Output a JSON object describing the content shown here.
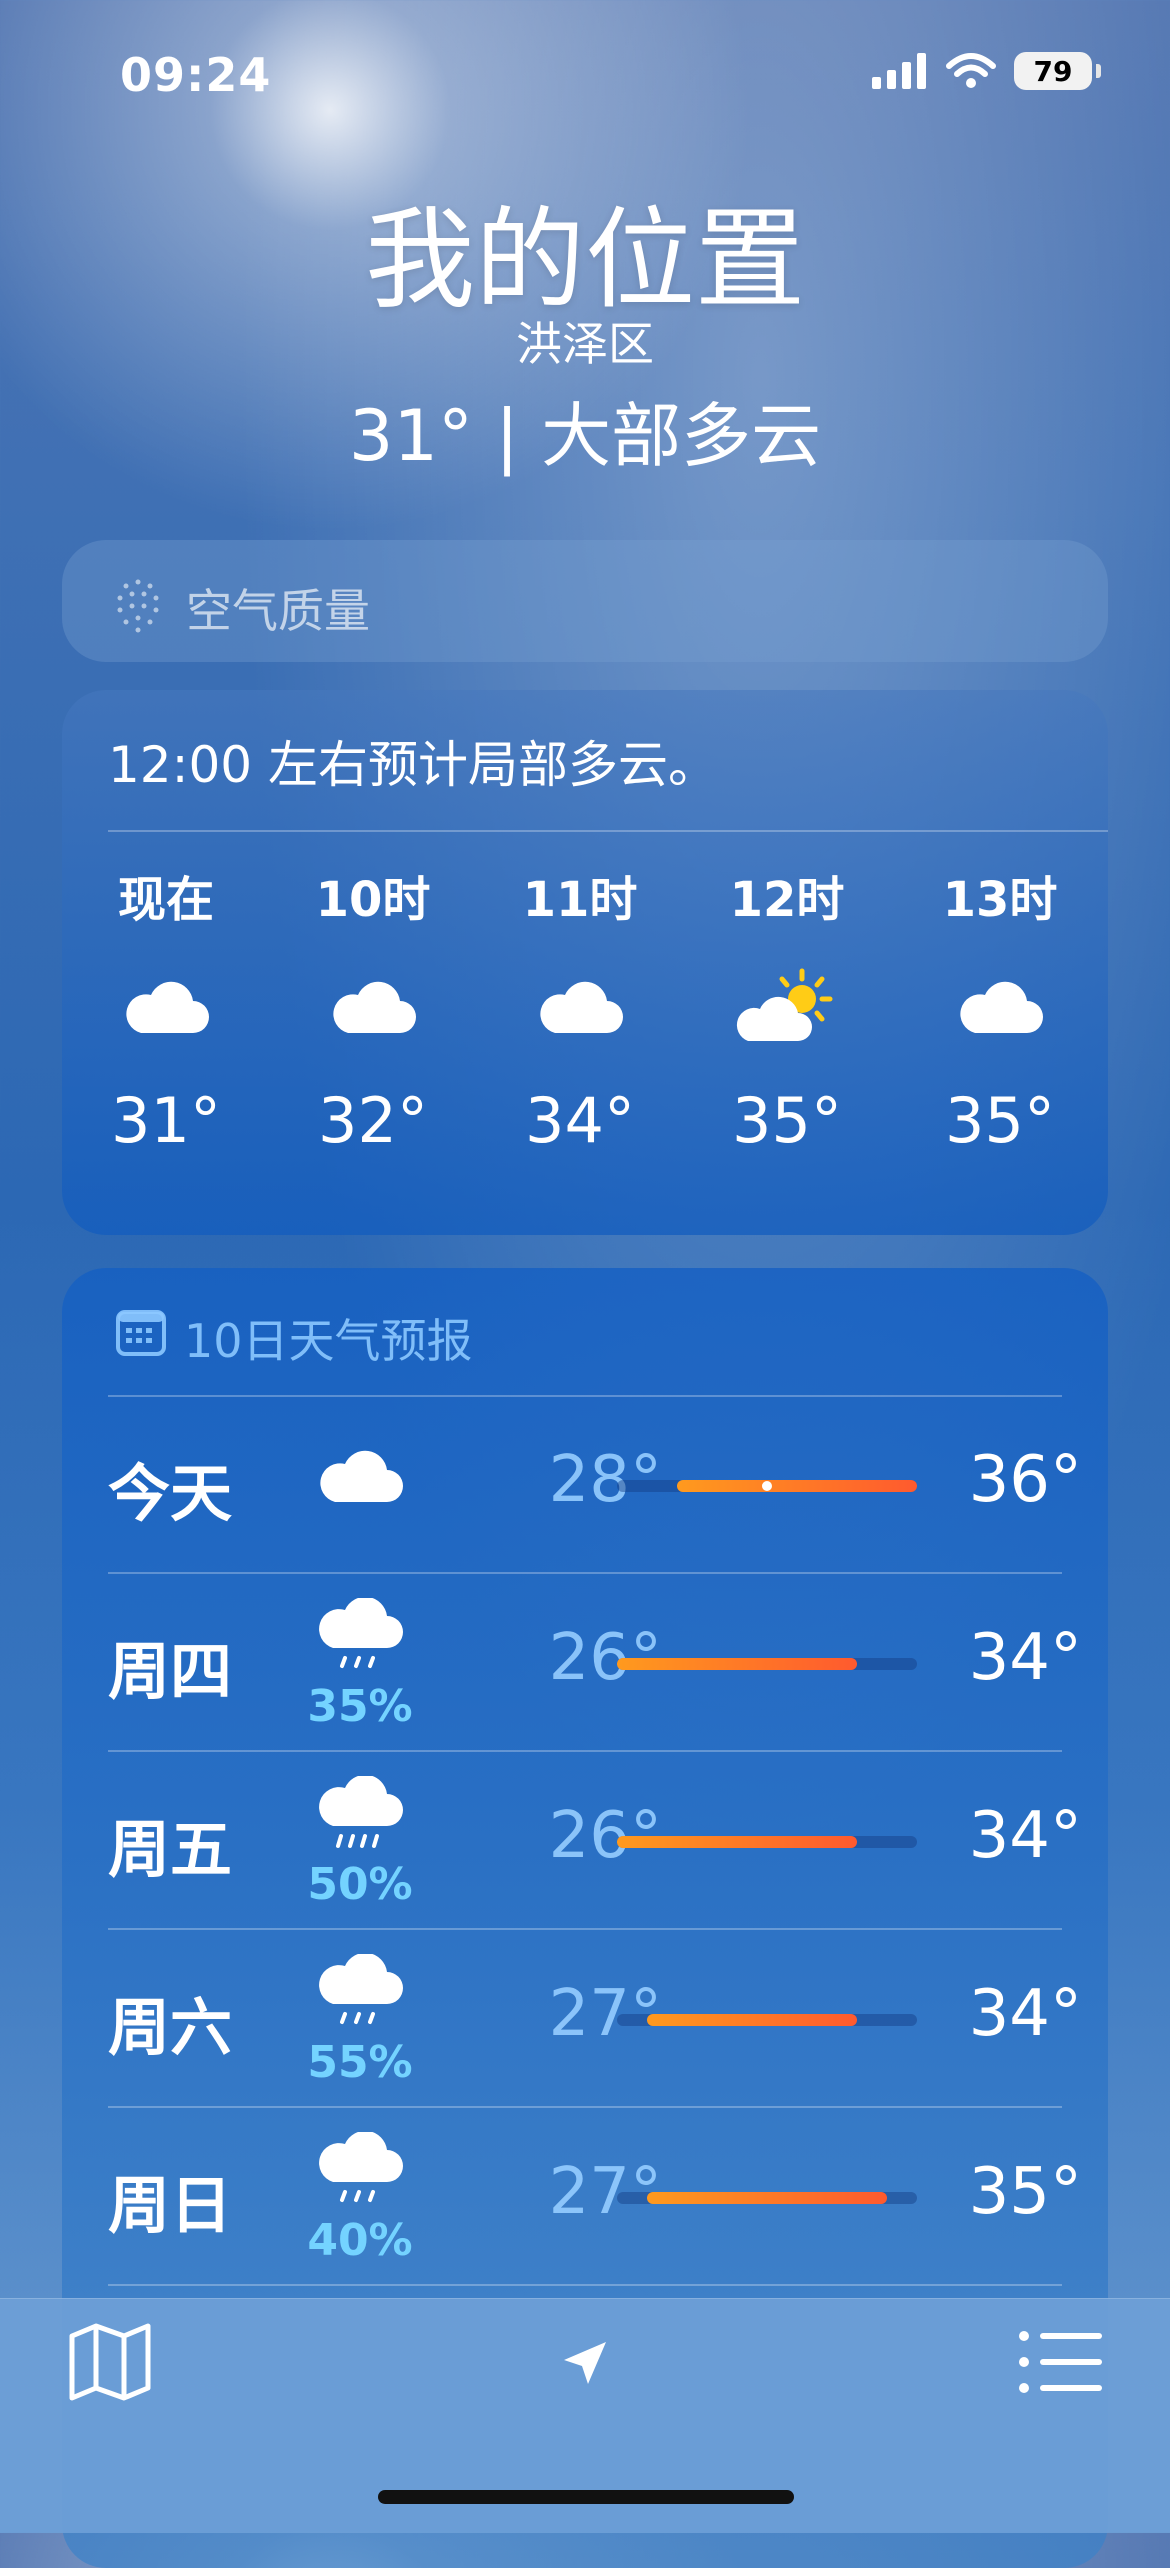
{
  "status_bar": {
    "time": "09:24",
    "battery": "79"
  },
  "header": {
    "title": "我的位置",
    "district": "洪泽区",
    "current": "31° | 大部多云"
  },
  "air_quality": {
    "label": "空气质量",
    "icon": "air-quality-dots-icon"
  },
  "hourly": {
    "summary": "12:00 左右预计局部多云。",
    "items": [
      {
        "label": "现在",
        "icon": "cloud-icon",
        "temp": "31°"
      },
      {
        "label": "10时",
        "icon": "cloud-icon",
        "temp": "32°"
      },
      {
        "label": "11时",
        "icon": "cloud-icon",
        "temp": "34°"
      },
      {
        "label": "12时",
        "icon": "partly-sunny-icon",
        "temp": "35°"
      },
      {
        "label": "13时",
        "icon": "cloud-icon",
        "temp": "35°"
      }
    ]
  },
  "daily": {
    "title": "10日天气预报",
    "scale": {
      "min": 26,
      "max": 36
    },
    "rows": [
      {
        "day": "今天",
        "icon": "cloud-icon",
        "precip": "",
        "low": "28°",
        "high": "36°",
        "low_value": 28,
        "high_value": 36,
        "current_value": 31
      },
      {
        "day": "周四",
        "icon": "rain-icon",
        "precip": "35%",
        "low": "26°",
        "high": "34°",
        "low_value": 26,
        "high_value": 34
      },
      {
        "day": "周五",
        "icon": "rain-icon",
        "precip": "50%",
        "low": "26°",
        "high": "34°",
        "low_value": 26,
        "high_value": 34
      },
      {
        "day": "周六",
        "icon": "rain-icon",
        "precip": "55%",
        "low": "27°",
        "high": "34°",
        "low_value": 27,
        "high_value": 34
      },
      {
        "day": "周日",
        "icon": "rain-icon",
        "precip": "40%",
        "low": "27°",
        "high": "35°",
        "low_value": 27,
        "high_value": 35
      }
    ]
  },
  "toolbar": {
    "map_icon": "map-icon",
    "location_icon": "location-arrow-icon",
    "list_icon": "list-icon"
  },
  "colors": {
    "bar_start": "#ff9a1e",
    "bar_end": "#ff5a2e",
    "precip": "#74d3ff"
  }
}
